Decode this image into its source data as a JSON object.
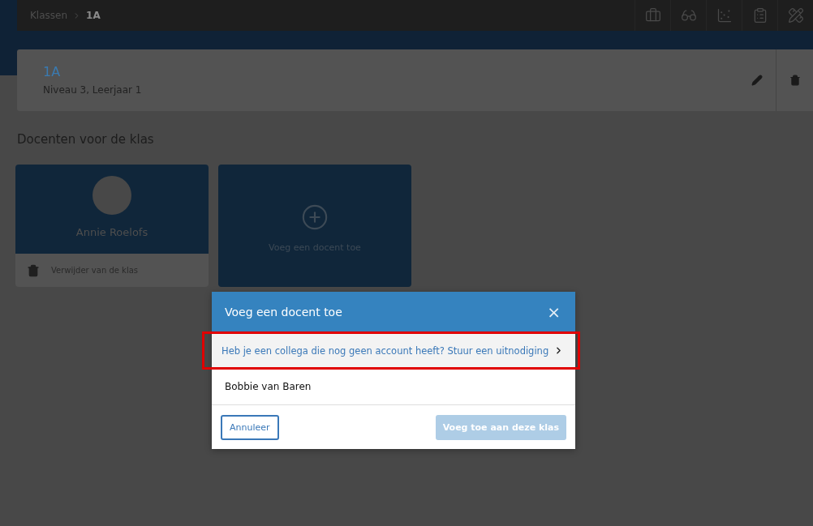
{
  "breadcrumb": [
    {
      "label": "Klassen",
      "current": false
    },
    {
      "label": "1A",
      "current": true
    }
  ],
  "toolbar": [
    {
      "kind": "briefcase"
    },
    {
      "kind": "glasses"
    },
    {
      "kind": "scatter"
    },
    {
      "kind": "clipboard"
    },
    {
      "kind": "tools"
    }
  ],
  "class_card": {
    "title": "1A",
    "subtitle": "Niveau 3, Leerjaar 1"
  },
  "section_title": "Docenten voor de klas",
  "teachers": [
    {
      "name": "Annie Roelofs",
      "action": "Verwijder van de klas"
    }
  ],
  "add_teacher": {
    "label": "Voeg een docent toe"
  },
  "modal": {
    "title": "Voeg een docent toe",
    "close": "×",
    "invite": {
      "text": "Heb je een collega die nog geen account heeft? Stuur een uitnodiging",
      "highlighted": true
    },
    "candidates": [
      {
        "name": "Bobbie van Baren",
        "selected": false
      }
    ],
    "buttons": [
      {
        "label": "Annuleer",
        "kind": "secondary",
        "disabled": false
      },
      {
        "label": "Voeg toe aan deze klas",
        "kind": "primary",
        "disabled": true
      }
    ]
  }
}
